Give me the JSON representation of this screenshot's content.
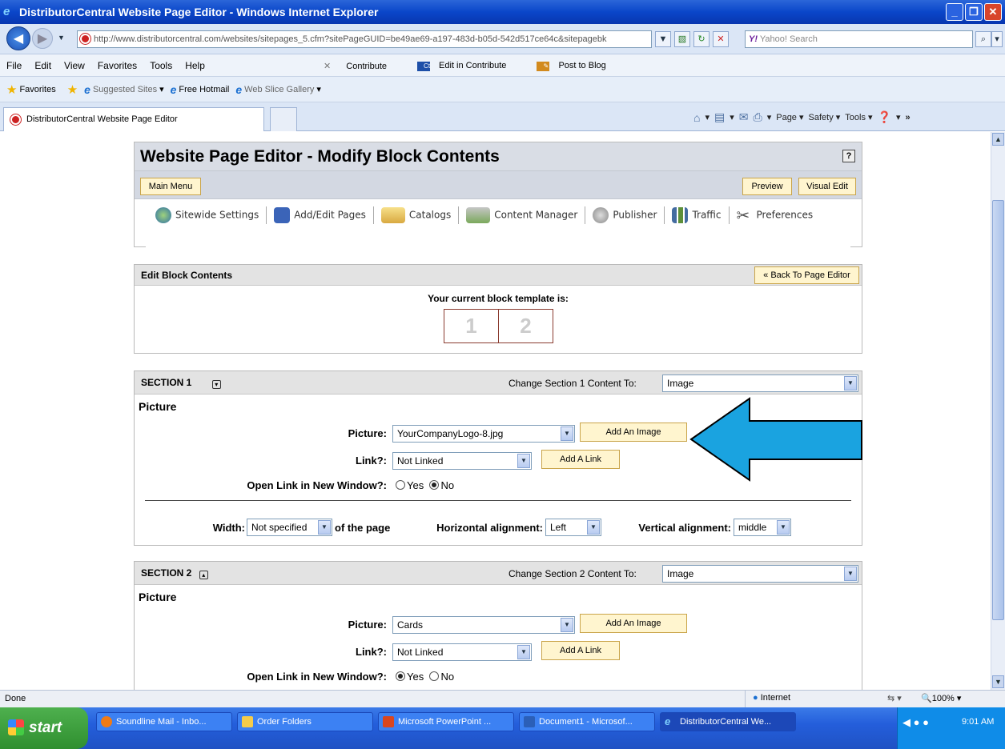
{
  "window": {
    "title": "DistributorCentral Website Page Editor - Windows Internet Explorer"
  },
  "address": {
    "url": "http://www.distributorcentral.com/websites/sitepages_5.cfm?sitePageGUID=be49ae69-a197-483d-b05d-542d517ce64c&sitepagebk",
    "search_placeholder": "Yahoo! Search"
  },
  "menu": {
    "items": [
      "File",
      "Edit",
      "View",
      "Favorites",
      "Tools",
      "Help"
    ],
    "contribute": "Contribute",
    "edit_contribute": "Edit in Contribute",
    "post_blog": "Post to Blog"
  },
  "favbar": {
    "favorites": "Favorites",
    "suggested": "Suggested Sites",
    "hotmail": "Free Hotmail",
    "webslice": "Web Slice Gallery"
  },
  "tab": {
    "label": "DistributorCentral Website Page Editor"
  },
  "commandbar": {
    "page": "Page",
    "safety": "Safety",
    "tools": "Tools"
  },
  "editor": {
    "title": "Website Page Editor - Modify Block Contents",
    "help": "?",
    "main_menu": "Main Menu",
    "preview": "Preview",
    "visual_edit": "Visual Edit",
    "toolbar": [
      "Sitewide Settings",
      "Add/Edit Pages",
      "Catalogs",
      "Content Manager",
      "Publisher",
      "Traffic",
      "Preferences"
    ]
  },
  "edit_block": {
    "heading": "Edit Block Contents",
    "back_button": "« Back To Page Editor",
    "template_label": "Your current block template is:",
    "template_cells": [
      "1",
      "2"
    ]
  },
  "section1": {
    "heading": "SECTION 1",
    "change_label": "Change Section 1 Content To:",
    "content_type": "Image",
    "subheading": "Picture",
    "picture_label": "Picture:",
    "picture_value": "YourCompanyLogo-8.jpg",
    "add_image": "Add An Image",
    "link_label": "Link?:",
    "link_value": "Not Linked",
    "add_link": "Add A Link",
    "newwin_label": "Open Link in New Window?:",
    "yes": "Yes",
    "no": "No",
    "width_label": "Width:",
    "width_value": "Not specified",
    "of_page": "of the page",
    "halign_label": "Horizontal alignment:",
    "halign_value": "Left",
    "valign_label": "Vertical alignment:",
    "valign_value": "middle"
  },
  "section2": {
    "heading": "SECTION 2",
    "change_label": "Change Section 2 Content To:",
    "content_type": "Image",
    "subheading": "Picture",
    "picture_label": "Picture:",
    "picture_value": "Cards",
    "add_image": "Add An Image",
    "link_label": "Link?:",
    "link_value": "Not Linked",
    "add_link": "Add A Link",
    "newwin_label": "Open Link in New Window?:",
    "yes": "Yes",
    "no": "No"
  },
  "status": {
    "text": "Done",
    "zone": "Internet",
    "zoom": "100%"
  },
  "taskbar": {
    "start": "start",
    "tasks": [
      "Soundline Mail - Inbo...",
      "Order Folders",
      "Microsoft PowerPoint ...",
      "Document1 - Microsof...",
      "DistributorCentral We..."
    ],
    "clock": "9:01 AM"
  },
  "colors": {
    "annotation_arrow": "#1aa3e0",
    "title_bar": "#0a46c9",
    "button_fill": "#fff5cf"
  }
}
